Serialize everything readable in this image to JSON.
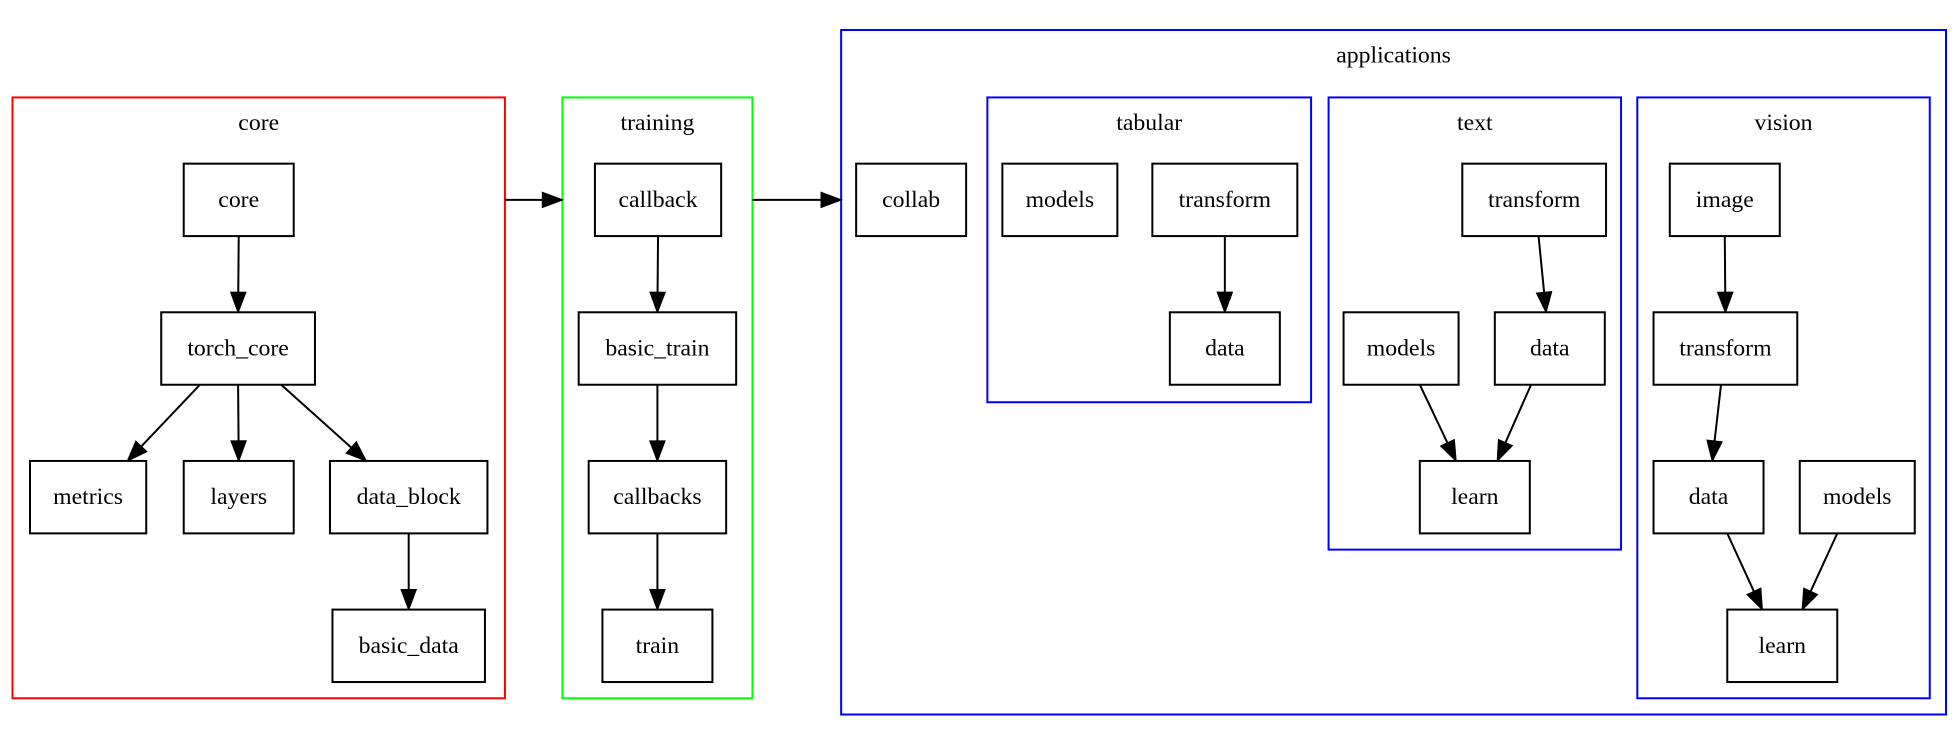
{
  "colors": {
    "core": "#ff0000",
    "training": "#00ff00",
    "applications": "#0000ff",
    "subcluster": "#0000ff",
    "node_stroke": "#000000",
    "background": "#ffffff"
  },
  "clusters": {
    "core": {
      "label": "core",
      "color": "#ff0000"
    },
    "training": {
      "label": "training",
      "color": "#00ff00"
    },
    "applications": {
      "label": "applications",
      "color": "#0000ff"
    },
    "tabular": {
      "label": "tabular",
      "color": "#0000ff"
    },
    "text": {
      "label": "text",
      "color": "#0000ff"
    },
    "vision": {
      "label": "vision",
      "color": "#0000ff"
    }
  },
  "nodes": {
    "core_core": "core",
    "core_torch_core": "torch_core",
    "core_metrics": "metrics",
    "core_layers": "layers",
    "core_data_block": "data_block",
    "core_basic_data": "basic_data",
    "training_callback": "callback",
    "training_basic_train": "basic_train",
    "training_callbacks": "callbacks",
    "training_train": "train",
    "app_collab": "collab",
    "tabular_models": "models",
    "tabular_transform": "transform",
    "tabular_data": "data",
    "text_transform": "transform",
    "text_models": "models",
    "text_data": "data",
    "text_learn": "learn",
    "vision_image": "image",
    "vision_transform": "transform",
    "vision_data": "data",
    "vision_models": "models",
    "vision_learn": "learn"
  },
  "edges": [
    {
      "from": "core_core",
      "to": "core_torch_core"
    },
    {
      "from": "core_torch_core",
      "to": "core_metrics"
    },
    {
      "from": "core_torch_core",
      "to": "core_layers"
    },
    {
      "from": "core_torch_core",
      "to": "core_data_block"
    },
    {
      "from": "core_data_block",
      "to": "core_basic_data"
    },
    {
      "from": "training_callback",
      "to": "training_basic_train"
    },
    {
      "from": "training_basic_train",
      "to": "training_callbacks"
    },
    {
      "from": "training_callbacks",
      "to": "training_train"
    },
    {
      "from": "tabular_transform",
      "to": "tabular_data"
    },
    {
      "from": "text_transform",
      "to": "text_data"
    },
    {
      "from": "text_models",
      "to": "text_learn"
    },
    {
      "from": "text_data",
      "to": "text_learn"
    },
    {
      "from": "vision_image",
      "to": "vision_transform"
    },
    {
      "from": "vision_transform",
      "to": "vision_data"
    },
    {
      "from": "vision_data",
      "to": "vision_learn"
    },
    {
      "from": "vision_models",
      "to": "vision_learn"
    },
    {
      "from": "cluster:core",
      "to": "cluster:training"
    },
    {
      "from": "cluster:training",
      "to": "cluster:applications"
    }
  ]
}
